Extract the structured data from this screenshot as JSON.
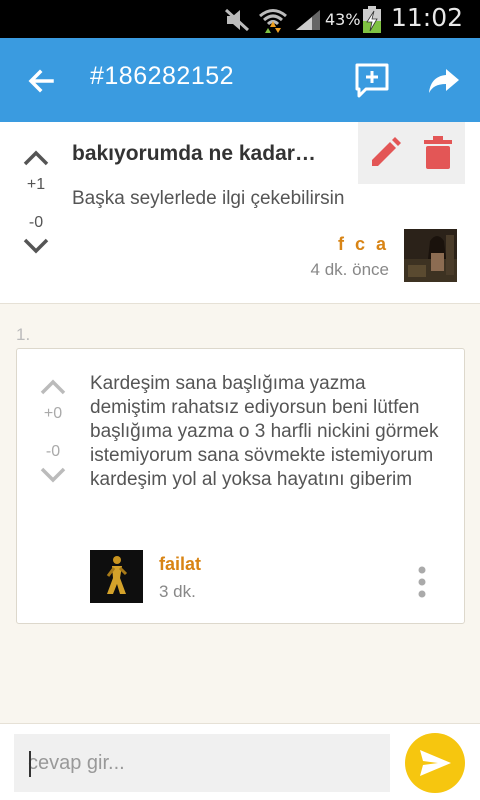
{
  "status_bar": {
    "battery_percent": "43%",
    "time": "11:02",
    "icons": [
      "mute-icon",
      "wifi-icon",
      "signal-icon",
      "battery-charging-icon"
    ]
  },
  "app_bar": {
    "title": "#186282152",
    "icons": [
      "back-arrow-icon",
      "add-comment-icon",
      "share-icon"
    ]
  },
  "topic": {
    "title": "bakıyorumda ne kadar…",
    "description": "Başka seylerlede ilgi çekebilirsin",
    "upvotes": "+1",
    "downvotes": "-0",
    "author": "f c a",
    "time": "4 dk. önce"
  },
  "replies": [
    {
      "index": "1.",
      "upvotes": "+0",
      "downvotes": "-0",
      "text": "Kardeşim sana başlığıma yazma demiştim rahatsız ediyorsun beni lütfen başlığıma yazma o 3 harfli nickini görmek istemiyorum sana sövmekte istemiyorum kardeşim yol al yoksa hayatını giberim",
      "author": "failat",
      "time": "3 dk."
    }
  ],
  "reply_input": {
    "placeholder": "cevap gir...",
    "value": ""
  },
  "colors": {
    "app_bar": "#3a9be0",
    "author": "#d88415",
    "send_button": "#f6c60f",
    "delete_icon": "#e35656",
    "edit_icon": "#e35656",
    "background": "#f9f6ef"
  }
}
